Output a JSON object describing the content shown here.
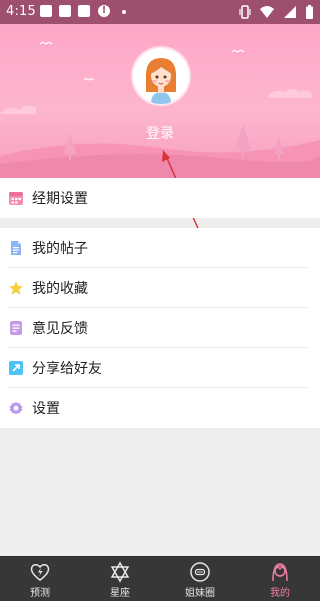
{
  "status_bar": {
    "time": "4:15"
  },
  "profile": {
    "login_label": "登录"
  },
  "menu_primary": [
    {
      "label": "经期设置",
      "icon": "calendar-icon",
      "color": "#f28fb4"
    }
  ],
  "menu_secondary": [
    {
      "label": "我的帖子",
      "icon": "document-icon",
      "color": "#8ab4f8"
    },
    {
      "label": "我的收藏",
      "icon": "star-icon",
      "color": "#f5cf3b"
    },
    {
      "label": "意见反馈",
      "icon": "feedback-icon",
      "color": "#c69ae8"
    },
    {
      "label": "分享给好友",
      "icon": "share-icon",
      "color": "#4fc3f7"
    },
    {
      "label": "设置",
      "icon": "gear-icon",
      "color": "#b897f0"
    }
  ],
  "tabbar": {
    "tabs": [
      {
        "label": "预测",
        "icon": "heart-bolt-icon",
        "active": false
      },
      {
        "label": "星座",
        "icon": "star-of-david-icon",
        "active": false
      },
      {
        "label": "姐妹圈",
        "icon": "chat-bubble-icon",
        "active": false
      },
      {
        "label": "我的",
        "icon": "girl-icon",
        "active": true
      }
    ],
    "active_color": "#f37da8"
  },
  "colors": {
    "status_bar": "#9e4e6e",
    "header_pink": "#fdb5cf",
    "accent": "#f37da8",
    "annotation_arrow": "#d9333a"
  }
}
